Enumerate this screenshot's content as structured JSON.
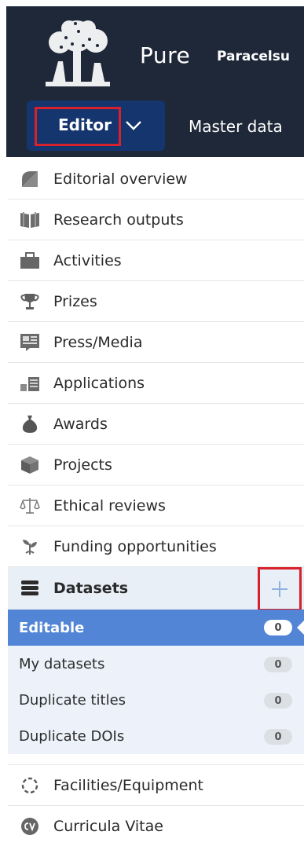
{
  "header": {
    "brand": "Pure",
    "organization": "Paracelsu",
    "role_menu": {
      "label": "Editor"
    },
    "master_data": "Master data"
  },
  "menu": {
    "items": [
      {
        "label": "Editorial overview",
        "icon": "editorial-overview-icon"
      },
      {
        "label": "Research outputs",
        "icon": "book-icon"
      },
      {
        "label": "Activities",
        "icon": "briefcase-icon"
      },
      {
        "label": "Prizes",
        "icon": "trophy-icon"
      },
      {
        "label": "Press/Media",
        "icon": "newspaper-icon"
      },
      {
        "label": "Applications",
        "icon": "applications-icon"
      },
      {
        "label": "Awards",
        "icon": "money-bag-icon"
      },
      {
        "label": "Projects",
        "icon": "cube-icon"
      },
      {
        "label": "Ethical reviews",
        "icon": "scales-icon"
      },
      {
        "label": "Funding opportunities",
        "icon": "sprout-icon"
      }
    ],
    "datasets": {
      "label": "Datasets",
      "icon": "database-icon",
      "add_icon": "plus-icon",
      "subitems": [
        {
          "label": "Editable",
          "count": "0",
          "selected": true
        },
        {
          "label": "My datasets",
          "count": "0"
        },
        {
          "label": "Duplicate titles",
          "count": "0"
        },
        {
          "label": "Duplicate DOIs",
          "count": "0"
        }
      ]
    },
    "after": [
      {
        "label": "Facilities/Equipment",
        "icon": "dashed-circle-icon"
      },
      {
        "label": "Curricula Vitae",
        "icon": "cv-icon"
      }
    ]
  },
  "colors": {
    "header_bg": "#1f2838",
    "editor_bg": "#15356e",
    "highlight": "#d8212a",
    "selected_bg": "#5385d6",
    "submenu_bg": "#edf2fa"
  }
}
